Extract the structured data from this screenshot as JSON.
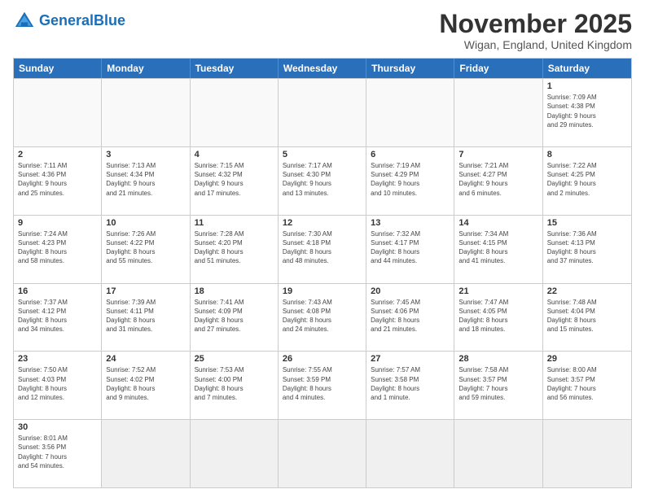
{
  "logo": {
    "text_general": "General",
    "text_blue": "Blue"
  },
  "header": {
    "month_title": "November 2025",
    "location": "Wigan, England, United Kingdom"
  },
  "weekdays": [
    "Sunday",
    "Monday",
    "Tuesday",
    "Wednesday",
    "Thursday",
    "Friday",
    "Saturday"
  ],
  "rows": [
    {
      "cells": [
        {
          "day": "",
          "empty": true
        },
        {
          "day": "",
          "empty": true
        },
        {
          "day": "",
          "empty": true
        },
        {
          "day": "",
          "empty": true
        },
        {
          "day": "",
          "empty": true
        },
        {
          "day": "",
          "empty": true
        },
        {
          "day": "1",
          "info": "Sunrise: 7:09 AM\nSunset: 4:38 PM\nDaylight: 9 hours\nand 29 minutes."
        }
      ]
    },
    {
      "cells": [
        {
          "day": "2",
          "info": "Sunrise: 7:11 AM\nSunset: 4:36 PM\nDaylight: 9 hours\nand 25 minutes."
        },
        {
          "day": "3",
          "info": "Sunrise: 7:13 AM\nSunset: 4:34 PM\nDaylight: 9 hours\nand 21 minutes."
        },
        {
          "day": "4",
          "info": "Sunrise: 7:15 AM\nSunset: 4:32 PM\nDaylight: 9 hours\nand 17 minutes."
        },
        {
          "day": "5",
          "info": "Sunrise: 7:17 AM\nSunset: 4:30 PM\nDaylight: 9 hours\nand 13 minutes."
        },
        {
          "day": "6",
          "info": "Sunrise: 7:19 AM\nSunset: 4:29 PM\nDaylight: 9 hours\nand 10 minutes."
        },
        {
          "day": "7",
          "info": "Sunrise: 7:21 AM\nSunset: 4:27 PM\nDaylight: 9 hours\nand 6 minutes."
        },
        {
          "day": "8",
          "info": "Sunrise: 7:22 AM\nSunset: 4:25 PM\nDaylight: 9 hours\nand 2 minutes."
        }
      ]
    },
    {
      "cells": [
        {
          "day": "9",
          "info": "Sunrise: 7:24 AM\nSunset: 4:23 PM\nDaylight: 8 hours\nand 58 minutes."
        },
        {
          "day": "10",
          "info": "Sunrise: 7:26 AM\nSunset: 4:22 PM\nDaylight: 8 hours\nand 55 minutes."
        },
        {
          "day": "11",
          "info": "Sunrise: 7:28 AM\nSunset: 4:20 PM\nDaylight: 8 hours\nand 51 minutes."
        },
        {
          "day": "12",
          "info": "Sunrise: 7:30 AM\nSunset: 4:18 PM\nDaylight: 8 hours\nand 48 minutes."
        },
        {
          "day": "13",
          "info": "Sunrise: 7:32 AM\nSunset: 4:17 PM\nDaylight: 8 hours\nand 44 minutes."
        },
        {
          "day": "14",
          "info": "Sunrise: 7:34 AM\nSunset: 4:15 PM\nDaylight: 8 hours\nand 41 minutes."
        },
        {
          "day": "15",
          "info": "Sunrise: 7:36 AM\nSunset: 4:13 PM\nDaylight: 8 hours\nand 37 minutes."
        }
      ]
    },
    {
      "cells": [
        {
          "day": "16",
          "info": "Sunrise: 7:37 AM\nSunset: 4:12 PM\nDaylight: 8 hours\nand 34 minutes."
        },
        {
          "day": "17",
          "info": "Sunrise: 7:39 AM\nSunset: 4:11 PM\nDaylight: 8 hours\nand 31 minutes."
        },
        {
          "day": "18",
          "info": "Sunrise: 7:41 AM\nSunset: 4:09 PM\nDaylight: 8 hours\nand 27 minutes."
        },
        {
          "day": "19",
          "info": "Sunrise: 7:43 AM\nSunset: 4:08 PM\nDaylight: 8 hours\nand 24 minutes."
        },
        {
          "day": "20",
          "info": "Sunrise: 7:45 AM\nSunset: 4:06 PM\nDaylight: 8 hours\nand 21 minutes."
        },
        {
          "day": "21",
          "info": "Sunrise: 7:47 AM\nSunset: 4:05 PM\nDaylight: 8 hours\nand 18 minutes."
        },
        {
          "day": "22",
          "info": "Sunrise: 7:48 AM\nSunset: 4:04 PM\nDaylight: 8 hours\nand 15 minutes."
        }
      ]
    },
    {
      "cells": [
        {
          "day": "23",
          "info": "Sunrise: 7:50 AM\nSunset: 4:03 PM\nDaylight: 8 hours\nand 12 minutes."
        },
        {
          "day": "24",
          "info": "Sunrise: 7:52 AM\nSunset: 4:02 PM\nDaylight: 8 hours\nand 9 minutes."
        },
        {
          "day": "25",
          "info": "Sunrise: 7:53 AM\nSunset: 4:00 PM\nDaylight: 8 hours\nand 7 minutes."
        },
        {
          "day": "26",
          "info": "Sunrise: 7:55 AM\nSunset: 3:59 PM\nDaylight: 8 hours\nand 4 minutes."
        },
        {
          "day": "27",
          "info": "Sunrise: 7:57 AM\nSunset: 3:58 PM\nDaylight: 8 hours\nand 1 minute."
        },
        {
          "day": "28",
          "info": "Sunrise: 7:58 AM\nSunset: 3:57 PM\nDaylight: 7 hours\nand 59 minutes."
        },
        {
          "day": "29",
          "info": "Sunrise: 8:00 AM\nSunset: 3:57 PM\nDaylight: 7 hours\nand 56 minutes."
        }
      ]
    },
    {
      "cells": [
        {
          "day": "30",
          "info": "Sunrise: 8:01 AM\nSunset: 3:56 PM\nDaylight: 7 hours\nand 54 minutes."
        },
        {
          "day": "",
          "empty": true
        },
        {
          "day": "",
          "empty": true
        },
        {
          "day": "",
          "empty": true
        },
        {
          "day": "",
          "empty": true
        },
        {
          "day": "",
          "empty": true
        },
        {
          "day": "",
          "empty": true
        }
      ]
    }
  ]
}
